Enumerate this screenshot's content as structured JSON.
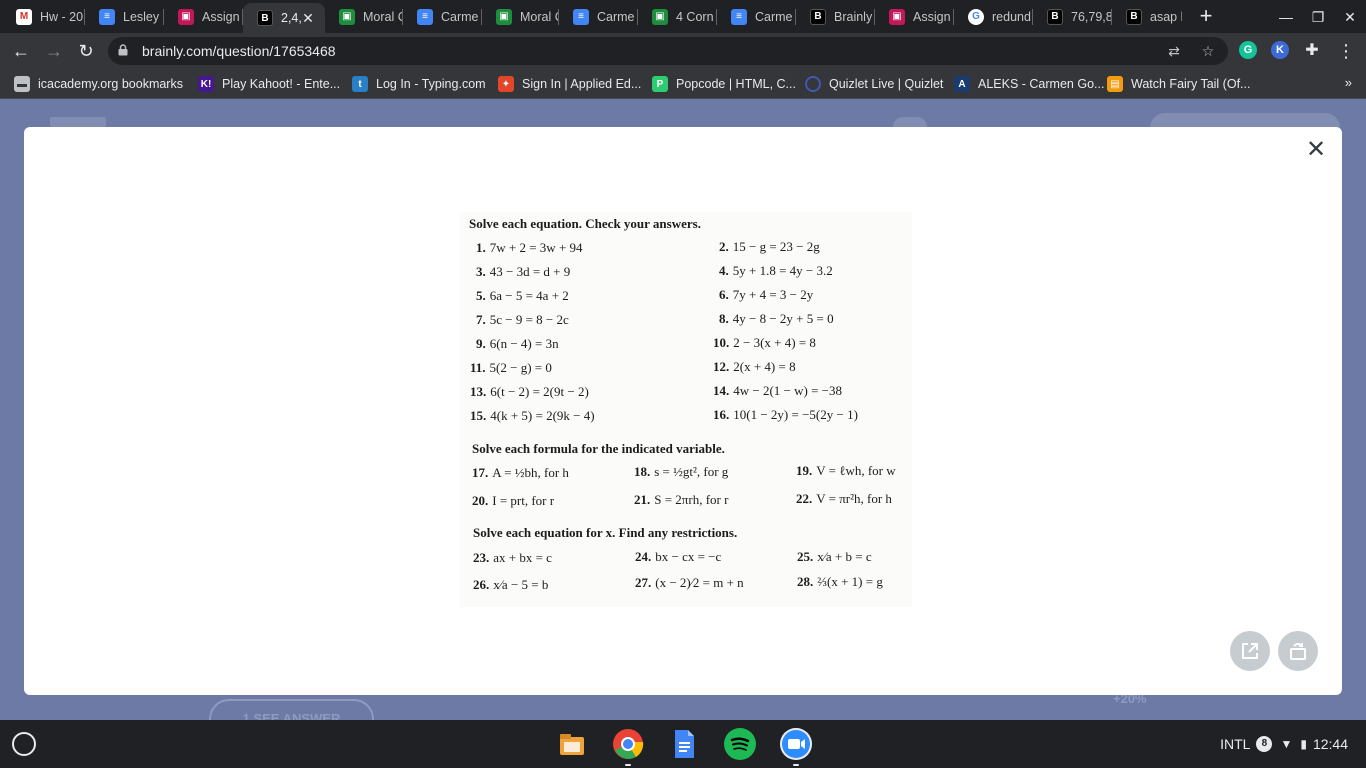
{
  "browser": {
    "tabs": [
      {
        "title": "Hw - 20",
        "favicon": "gmail-icon",
        "active": false
      },
      {
        "title": "Lesley",
        "favicon": "docs-icon",
        "active": false
      },
      {
        "title": "Assign",
        "favicon": "classroom-icon",
        "active": false
      },
      {
        "title": "2,4,",
        "favicon": "brainly-icon",
        "active": true
      },
      {
        "title": "Moral C",
        "favicon": "classroom-icon",
        "active": false
      },
      {
        "title": "Carme",
        "favicon": "docs-icon",
        "active": false
      },
      {
        "title": "Moral C",
        "favicon": "classroom-icon",
        "active": false
      },
      {
        "title": "Carme",
        "favicon": "docs-icon",
        "active": false
      },
      {
        "title": "4 Corn",
        "favicon": "classroom-icon",
        "active": false
      },
      {
        "title": "Carme",
        "favicon": "docs-icon",
        "active": false
      },
      {
        "title": "Brainly",
        "favicon": "brainly-icon",
        "active": false
      },
      {
        "title": "Assign",
        "favicon": "classroom-icon",
        "active": false
      },
      {
        "title": "redund",
        "favicon": "google-icon",
        "active": false
      },
      {
        "title": "76,79,8",
        "favicon": "brainly-icon",
        "active": false
      },
      {
        "title": "asap h",
        "favicon": "brainly-icon",
        "active": false
      }
    ],
    "url": "brainly.com/question/17653468",
    "bookmarks": [
      {
        "label": "icacademy.org bookmarks",
        "icon": "folder-icon"
      },
      {
        "label": "Play Kahoot! - Ente...",
        "icon": "kahoot-icon"
      },
      {
        "label": "Log In - Typing.com",
        "icon": "typing-icon"
      },
      {
        "label": "Sign In | Applied Ed...",
        "icon": "applied-ed-icon"
      },
      {
        "label": "Popcode | HTML, C...",
        "icon": "popcode-icon"
      },
      {
        "label": "Quizlet Live | Quizlet",
        "icon": "quizlet-icon"
      },
      {
        "label": "ALEKS - Carmen Go...",
        "icon": "aleks-icon"
      },
      {
        "label": "Watch Fairy Tail (Of...",
        "icon": "fairytail-icon"
      }
    ],
    "extensions": [
      {
        "name": "grammarly-icon",
        "glyph": "G",
        "color": "#15c39a"
      },
      {
        "name": "kami-icon",
        "glyph": "K",
        "color": "#3e6ad8"
      }
    ]
  },
  "page": {
    "see_answer": "1  SEE ANSWER",
    "points": "+20%"
  },
  "worksheet": {
    "section1_title": "Solve each equation. Check your answers.",
    "section1": [
      {
        "num": "1.",
        "text": "7w + 2 = 3w + 94"
      },
      {
        "num": "2.",
        "text": "15 − g = 23 − 2g"
      },
      {
        "num": "3.",
        "text": "43 − 3d = d + 9"
      },
      {
        "num": "4.",
        "text": "5y + 1.8 = 4y − 3.2"
      },
      {
        "num": "5.",
        "text": "6a − 5 = 4a + 2"
      },
      {
        "num": "6.",
        "text": "7y + 4 = 3 − 2y"
      },
      {
        "num": "7.",
        "text": "5c − 9 = 8 − 2c"
      },
      {
        "num": "8.",
        "text": "4y − 8 − 2y + 5 = 0"
      },
      {
        "num": "9.",
        "text": "6(n − 4) = 3n"
      },
      {
        "num": "10.",
        "text": "2 − 3(x + 4) = 8"
      },
      {
        "num": "11.",
        "text": "5(2 − g) = 0"
      },
      {
        "num": "12.",
        "text": "2(x + 4) = 8"
      },
      {
        "num": "13.",
        "text": "6(t − 2) = 2(9t − 2)"
      },
      {
        "num": "14.",
        "text": "4w − 2(1 − w) = −38"
      },
      {
        "num": "15.",
        "text": "4(k + 5) = 2(9k − 4)"
      },
      {
        "num": "16.",
        "text": "10(1 − 2y) = −5(2y − 1)"
      }
    ],
    "section2_title": "Solve each formula for the indicated variable.",
    "section2": [
      {
        "num": "17.",
        "text": "A = ½bh, for h"
      },
      {
        "num": "18.",
        "text": "s = ½gt², for g"
      },
      {
        "num": "19.",
        "text": "V = ℓwh, for w"
      },
      {
        "num": "20.",
        "text": "I = prt, for r"
      },
      {
        "num": "21.",
        "text": "S = 2πrh, for r"
      },
      {
        "num": "22.",
        "text": "V = πr²h, for h"
      }
    ],
    "section3_title": "Solve each equation for x. Find any restrictions.",
    "section3": [
      {
        "num": "23.",
        "text": "ax + bx = c"
      },
      {
        "num": "24.",
        "text": "bx − cx = −c"
      },
      {
        "num": "25.",
        "text": "x⁄a + b = c"
      },
      {
        "num": "26.",
        "text": "x⁄a − 5 = b"
      },
      {
        "num": "27.",
        "text": "(x − 2)⁄2 = m + n"
      },
      {
        "num": "28.",
        "text": "⅔(x + 1) = g"
      }
    ]
  },
  "shelf": {
    "apps": [
      {
        "name": "files-app-icon",
        "color": "#f0a23b"
      },
      {
        "name": "chrome-app-icon",
        "color": "#ea4335"
      },
      {
        "name": "docs-app-icon",
        "color": "#4285f4"
      },
      {
        "name": "spotify-app-icon",
        "color": "#1db954"
      },
      {
        "name": "zoom-app-icon",
        "color": "#2d8cff"
      }
    ],
    "ime": "INTL",
    "notification_count": "8",
    "time": "12:44"
  }
}
